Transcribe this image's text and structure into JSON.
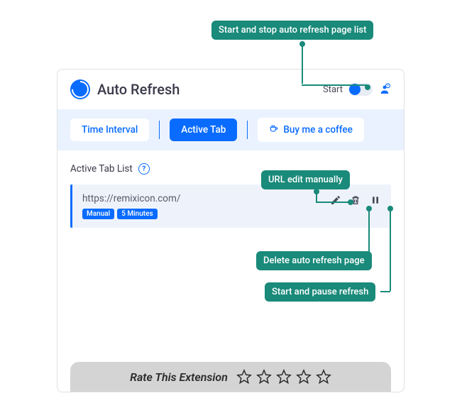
{
  "header": {
    "app_title": "Auto Refresh",
    "start_label": "Start"
  },
  "callouts": {
    "top": "Start and stop auto refresh page list",
    "edit": "URL edit manually",
    "delete": "Delete auto refresh page",
    "pause": "Start and pause refresh"
  },
  "tabs": {
    "time_interval": "Time Interval",
    "active_tab": "Active Tab",
    "coffee": "Buy me a coffee"
  },
  "list": {
    "title": "Active Tab List",
    "help_glyph": "?"
  },
  "item": {
    "url": "https://remixicon.com/",
    "badge1": "Manual",
    "badge2": "5 Minutes"
  },
  "rating": {
    "label": "Rate This Extension"
  }
}
